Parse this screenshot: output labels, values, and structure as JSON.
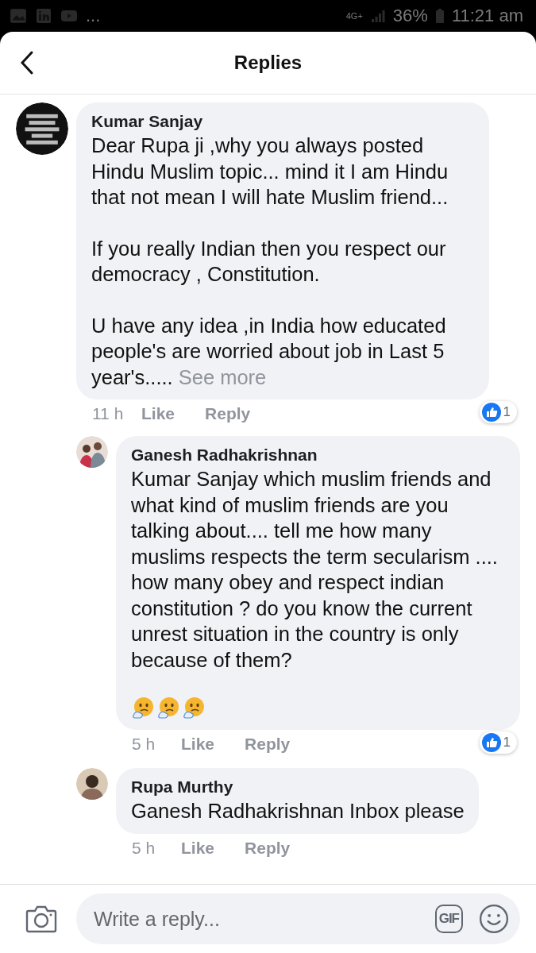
{
  "status_bar": {
    "overflow": "...",
    "network": "4G+",
    "battery": "36%",
    "time": "11:21 am"
  },
  "header": {
    "title": "Replies"
  },
  "comments": [
    {
      "author": "Kumar Sanjay",
      "nested": false,
      "paragraphs": [
        "Dear Rupa ji ,why you always posted Hindu Muslim topic... mind it I am Hindu that not mean I will hate Muslim friend...",
        "If you really Indian then you respect our democracy , Constitution.",
        "U have any idea ,in India how educated people's are worried about job in Last 5 year's....."
      ],
      "see_more": "See more",
      "emoji_row": false,
      "time": "11 h",
      "like": "Like",
      "reply": "Reply",
      "reactions": "1"
    },
    {
      "author": "Ganesh Radhakrishnan",
      "nested": true,
      "paragraphs": [
        "Kumar Sanjay which muslim friends and what kind of muslim friends are you talking about.... tell me how many muslims respects the term secularism .... how many obey and respect indian constitution ? do you know the current unrest situation in the country is only because of them?"
      ],
      "emoji_row": true,
      "time": "5 h",
      "like": "Like",
      "reply": "Reply",
      "reactions": "1"
    },
    {
      "author": "Rupa Murthy",
      "nested": true,
      "paragraphs": [
        "Ganesh Radhakrishnan Inbox please"
      ],
      "emoji_row": false,
      "time": "5 h",
      "like": "Like",
      "reply": "Reply"
    }
  ],
  "composer": {
    "placeholder": "Write a reply...",
    "gif": "GIF"
  }
}
